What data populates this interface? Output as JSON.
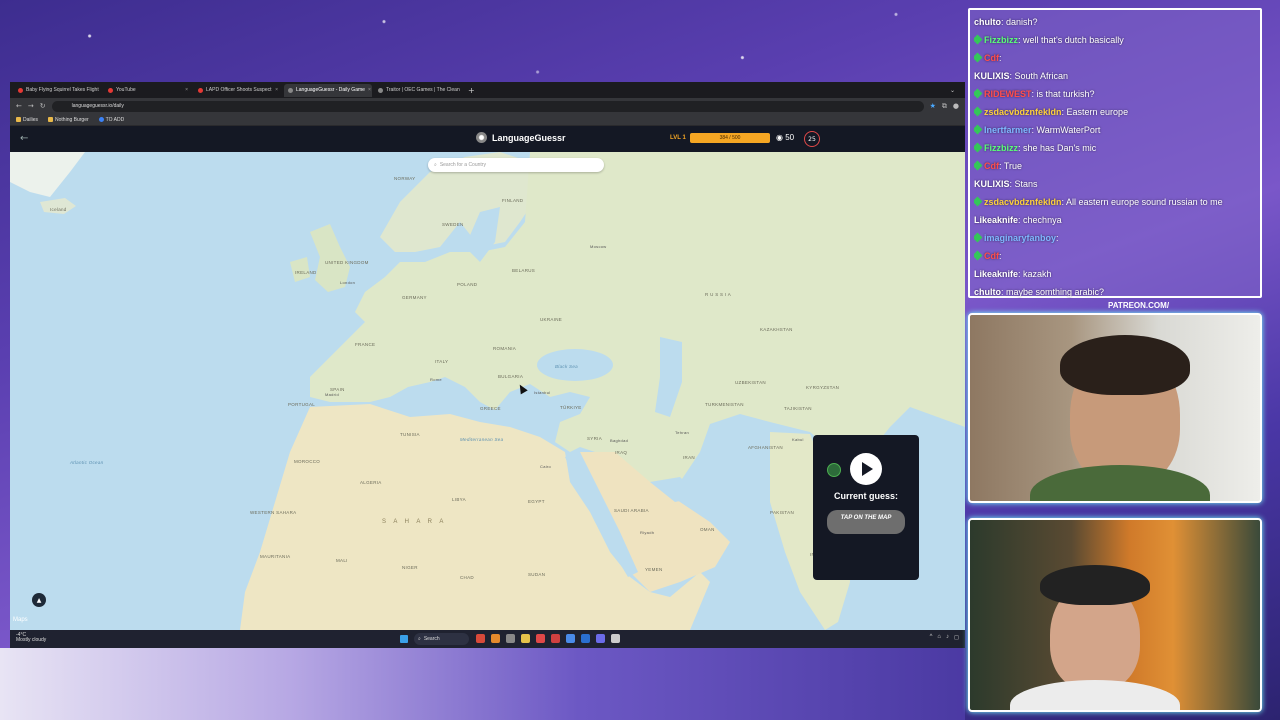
{
  "browser": {
    "tabs": [
      {
        "label": "Baby Flying Squirrel Takes Flight",
        "color": "#e53935",
        "active": false
      },
      {
        "label": "YouTube",
        "color": "#e53935",
        "active": false
      },
      {
        "label": "LAPD Officer Shoots Suspect",
        "color": "#e53935",
        "active": false
      },
      {
        "label": "LanguageGuessr - Daily Game",
        "color": "#888888",
        "active": true
      },
      {
        "label": "Traitor | OEC Games | The Clean",
        "color": "#888888",
        "active": false
      }
    ],
    "url": "languageguessr.io/daily",
    "bookmarks": [
      "Dailies",
      "Nothing Burger",
      "TO ADD"
    ]
  },
  "app": {
    "name": "LanguageGuessr",
    "level": "LVL 1",
    "xp": "384 / 500",
    "coins": "50",
    "timer": "25",
    "search_placeholder": "Search for a Country"
  },
  "map": {
    "labels": {
      "iceland": "Iceland",
      "norway": "NORWAY",
      "sweden": "SWEDEN",
      "finland": "FINLAND",
      "uk": "UNITED KINGDOM",
      "ireland": "IRELAND",
      "germany": "GERMANY",
      "poland": "POLAND",
      "belarus": "BELARUS",
      "ukraine": "UKRAINE",
      "france": "FRANCE",
      "spain": "SPAIN",
      "portugal": "PORTUGAL",
      "italy": "ITALY",
      "romania": "ROMANIA",
      "bulgaria": "BULGARIA",
      "greece": "GREECE",
      "turkiye": "TÜRKIYE",
      "russia": "R U S S I A",
      "kazakhstan": "KAZAKHSTAN",
      "uzbekistan": "UZBEKISTAN",
      "turkmenistan": "TURKMENISTAN",
      "kyrgyzstan": "KYRGYZSTAN",
      "tajikistan": "TAJIKISTAN",
      "afghanistan": "AFGHANISTAN",
      "iran": "IRAN",
      "iraq": "IRAQ",
      "syria": "SYRIA",
      "saudi": "SAUDI ARABIA",
      "egypt": "EGYPT",
      "libya": "LIBYA",
      "algeria": "ALGERIA",
      "morocco": "MOROCCO",
      "tunisia": "TUNISIA",
      "mali": "MALI",
      "niger": "NIGER",
      "chad": "CHAD",
      "sudan": "SUDAN",
      "mauritania": "MAURITANIA",
      "western_sahara": "WESTERN SAHARA",
      "yemen": "YEMEN",
      "oman": "OMAN",
      "pakistan": "PAKISTAN",
      "india": "INDIA",
      "sahara": "S A H A R A",
      "med_sea": "Mediterranean Sea",
      "black_sea": "Black Sea",
      "atlantic": "Atlantic Ocean",
      "moscow": "Moscow",
      "london": "London",
      "madrid": "Madrid",
      "rome": "Rome",
      "istanbul": "Istanbul",
      "tehran": "Tehran",
      "cairo": "Cairo",
      "kabul": "Kabul",
      "riyadh": "Riyadh",
      "baghdad": "Baghdad"
    },
    "attribution": "Maps"
  },
  "guess_panel": {
    "title": "Current guess:",
    "button": "TAP ON THE MAP"
  },
  "taskbar": {
    "weather_temp": "-4°C",
    "weather_desc": "Mostly cloudy",
    "search": "Search"
  },
  "chat": [
    {
      "user": "chulto",
      "text": "danish?",
      "color": "#ffffff"
    },
    {
      "user": "Fizzbizz",
      "text": "well that's dutch basically",
      "color": "#5aff7a"
    },
    {
      "user": "Cdf",
      "text": "",
      "color": "#ff4d4d"
    },
    {
      "user": "KULIXIS",
      "text": "South African",
      "color": "#ffffff"
    },
    {
      "user": "RIDEWEST",
      "text": "is that turkish?",
      "color": "#ff4d4d"
    },
    {
      "user": "zsdacvbdznfekldn",
      "text": "Eastern europe",
      "color": "#ffd23a"
    },
    {
      "user": "Inertfarmer",
      "text": "WarmWaterPort",
      "color": "#7fb7ff"
    },
    {
      "user": "Fizzbizz",
      "text": "she has Dan's mic",
      "color": "#5aff7a"
    },
    {
      "user": "Cdf",
      "text": "True",
      "color": "#ff4d4d"
    },
    {
      "user": "KULIXIS",
      "text": "Stans",
      "color": "#ffffff"
    },
    {
      "user": "zsdacvbdznfekldn",
      "text": "All eastern europe sound russian to me",
      "color": "#ffd23a"
    },
    {
      "user": "Likeaknife",
      "text": "chechnya",
      "color": "#ffffff"
    },
    {
      "user": "imaginaryfanboy",
      "text": "",
      "color": "#7fb7ff"
    },
    {
      "user": "Cdf",
      "text": "",
      "color": "#ff4d4d"
    },
    {
      "user": "Likeaknife",
      "text": "kazakh",
      "color": "#ffffff"
    },
    {
      "user": "chulto",
      "text": "maybe somthing arabic?",
      "color": "#ffffff"
    }
  ],
  "overlay": {
    "patreon": "PATREON.COM/"
  }
}
